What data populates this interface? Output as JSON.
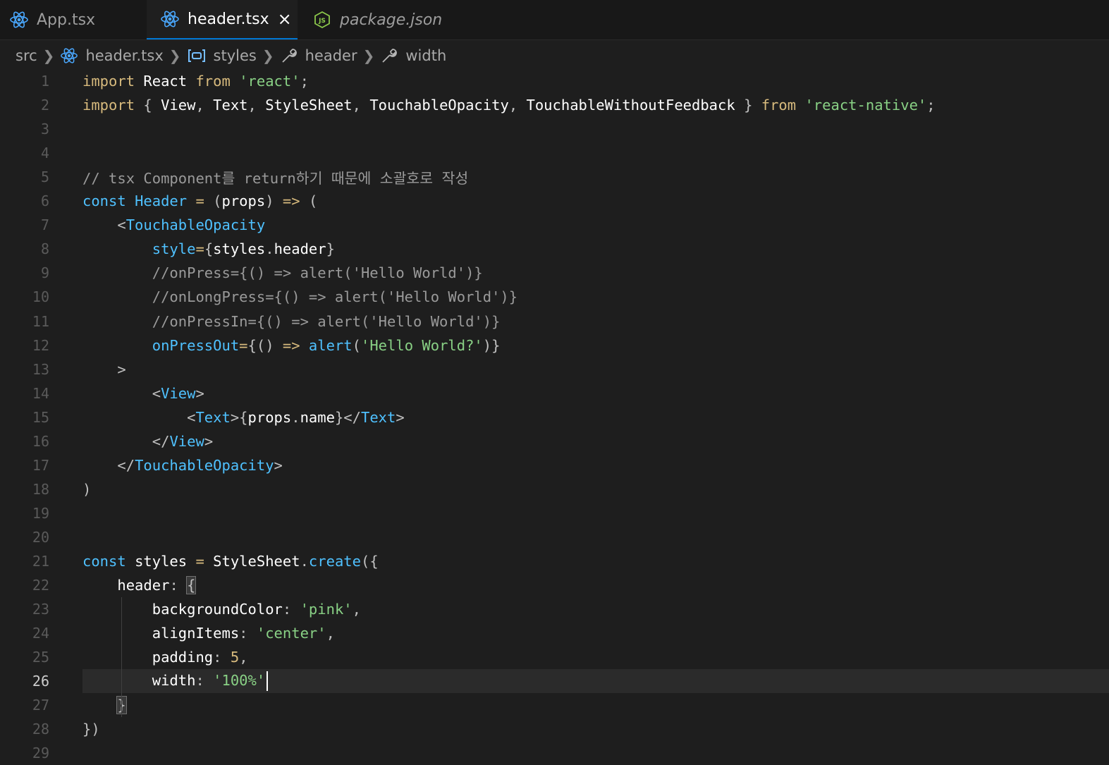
{
  "tabs": [
    {
      "label": "App.tsx",
      "icon": "react-icon",
      "active": false
    },
    {
      "label": "header.tsx",
      "icon": "react-icon",
      "active": true,
      "close": "×"
    },
    {
      "label": "package.json",
      "icon": "nodejs-icon",
      "active": false
    }
  ],
  "breadcrumb": [
    {
      "label": "src"
    },
    {
      "label": "header.tsx",
      "icon": "react-icon"
    },
    {
      "label": "styles",
      "icon": "variable-icon"
    },
    {
      "label": "header",
      "icon": "wrench-icon"
    },
    {
      "label": "width",
      "icon": "wrench-icon"
    }
  ],
  "colors": {
    "keyword": "#c586c0",
    "import": "#d7ba7d",
    "string": "#89d185",
    "identifier": "#ffffff",
    "type": "#4fc1ff",
    "comment": "#9a9a9a",
    "tag": "#4ec9b0",
    "number": "#d7ba7d"
  },
  "editor": {
    "current_line": 26,
    "lines": [
      {
        "n": "1",
        "tokens": [
          [
            "kwy",
            "import"
          ],
          [
            "p",
            " "
          ],
          [
            "id",
            "React"
          ],
          [
            "p",
            " "
          ],
          [
            "kwy",
            "from"
          ],
          [
            "p",
            " "
          ],
          [
            "str",
            "'react'"
          ],
          [
            "pu",
            ";"
          ]
        ]
      },
      {
        "n": "2",
        "tokens": [
          [
            "kwy",
            "import"
          ],
          [
            "p",
            " "
          ],
          [
            "pu",
            "{"
          ],
          [
            "p",
            " "
          ],
          [
            "id",
            "View"
          ],
          [
            "pu",
            ","
          ],
          [
            "p",
            " "
          ],
          [
            "id",
            "Text"
          ],
          [
            "pu",
            ","
          ],
          [
            "p",
            " "
          ],
          [
            "id",
            "StyleSheet"
          ],
          [
            "pu",
            ","
          ],
          [
            "p",
            " "
          ],
          [
            "id",
            "TouchableOpacity"
          ],
          [
            "pu",
            ","
          ],
          [
            "p",
            " "
          ],
          [
            "id",
            "TouchableWithoutFeedback"
          ],
          [
            "p",
            " "
          ],
          [
            "pu",
            "}"
          ],
          [
            "p",
            " "
          ],
          [
            "kwy",
            "from"
          ],
          [
            "p",
            " "
          ],
          [
            "str",
            "'react-native'"
          ],
          [
            "pu",
            ";"
          ]
        ]
      },
      {
        "n": "3",
        "tokens": []
      },
      {
        "n": "4",
        "tokens": []
      },
      {
        "n": "5",
        "tokens": [
          [
            "cm",
            "// tsx Component를 return하기 때문에 소괄호로 작성"
          ]
        ]
      },
      {
        "n": "6",
        "tokens": [
          [
            "kwb",
            "const"
          ],
          [
            "p",
            " "
          ],
          [
            "ty",
            "Header"
          ],
          [
            "p",
            " "
          ],
          [
            "op",
            "="
          ],
          [
            "p",
            " "
          ],
          [
            "pu",
            "("
          ],
          [
            "id",
            "props"
          ],
          [
            "pu",
            ")"
          ],
          [
            "p",
            " "
          ],
          [
            "kwy",
            "=>"
          ],
          [
            "p",
            " "
          ],
          [
            "pu",
            "("
          ]
        ]
      },
      {
        "n": "7",
        "tokens": [
          [
            "p",
            "    "
          ],
          [
            "pu",
            "<"
          ],
          [
            "tg",
            "TouchableOpacity"
          ]
        ]
      },
      {
        "n": "8",
        "tokens": [
          [
            "p",
            "        "
          ],
          [
            "at",
            "style"
          ],
          [
            "op",
            "="
          ],
          [
            "pu",
            "{"
          ],
          [
            "id",
            "styles"
          ],
          [
            "pu",
            "."
          ],
          [
            "id",
            "header"
          ],
          [
            "pu",
            "}"
          ]
        ]
      },
      {
        "n": "9",
        "tokens": [
          [
            "p",
            "        "
          ],
          [
            "cm",
            "//onPress={() => alert('Hello World')}"
          ]
        ]
      },
      {
        "n": "10",
        "tokens": [
          [
            "p",
            "        "
          ],
          [
            "cm",
            "//onLongPress={() => alert('Hello World')}"
          ]
        ]
      },
      {
        "n": "11",
        "tokens": [
          [
            "p",
            "        "
          ],
          [
            "cm",
            "//onPressIn={() => alert('Hello World')}"
          ]
        ]
      },
      {
        "n": "12",
        "tokens": [
          [
            "p",
            "        "
          ],
          [
            "at",
            "onPressOut"
          ],
          [
            "op",
            "="
          ],
          [
            "pu",
            "{"
          ],
          [
            "pu",
            "()"
          ],
          [
            "p",
            " "
          ],
          [
            "kwy",
            "=>"
          ],
          [
            "p",
            " "
          ],
          [
            "fn",
            "alert"
          ],
          [
            "pu",
            "("
          ],
          [
            "str",
            "'Hello World?'"
          ],
          [
            "pu",
            ")}"
          ]
        ]
      },
      {
        "n": "13",
        "tokens": [
          [
            "p",
            "    "
          ],
          [
            "pu",
            ">"
          ]
        ]
      },
      {
        "n": "14",
        "tokens": [
          [
            "p",
            "        "
          ],
          [
            "pu",
            "<"
          ],
          [
            "tg",
            "View"
          ],
          [
            "pu",
            ">"
          ]
        ]
      },
      {
        "n": "15",
        "tokens": [
          [
            "p",
            "            "
          ],
          [
            "pu",
            "<"
          ],
          [
            "tg",
            "Text"
          ],
          [
            "pu",
            ">"
          ],
          [
            "pu",
            "{"
          ],
          [
            "id",
            "props"
          ],
          [
            "pu",
            "."
          ],
          [
            "id",
            "name"
          ],
          [
            "pu",
            "}"
          ],
          [
            "pu",
            "</"
          ],
          [
            "tg",
            "Text"
          ],
          [
            "pu",
            ">"
          ]
        ]
      },
      {
        "n": "16",
        "tokens": [
          [
            "p",
            "        "
          ],
          [
            "pu",
            "</"
          ],
          [
            "tg",
            "View"
          ],
          [
            "pu",
            ">"
          ]
        ]
      },
      {
        "n": "17",
        "tokens": [
          [
            "p",
            "    "
          ],
          [
            "pu",
            "</"
          ],
          [
            "tg",
            "TouchableOpacity"
          ],
          [
            "pu",
            ">"
          ]
        ]
      },
      {
        "n": "18",
        "tokens": [
          [
            "pu",
            ")"
          ]
        ]
      },
      {
        "n": "19",
        "tokens": []
      },
      {
        "n": "20",
        "tokens": []
      },
      {
        "n": "21",
        "tokens": [
          [
            "kwb",
            "const"
          ],
          [
            "p",
            " "
          ],
          [
            "id",
            "styles"
          ],
          [
            "p",
            " "
          ],
          [
            "op",
            "="
          ],
          [
            "p",
            " "
          ],
          [
            "id",
            "StyleSheet"
          ],
          [
            "pu",
            "."
          ],
          [
            "fn",
            "create"
          ],
          [
            "pu",
            "({"
          ]
        ]
      },
      {
        "n": "22",
        "tokens": [
          [
            "p",
            "    "
          ],
          [
            "id",
            "header"
          ],
          [
            "pu",
            ":"
          ],
          [
            "p",
            " "
          ],
          [
            "bx",
            "{"
          ]
        ]
      },
      {
        "n": "23",
        "tokens": [
          [
            "p",
            "        "
          ],
          [
            "id",
            "backgroundColor"
          ],
          [
            "pu",
            ":"
          ],
          [
            "p",
            " "
          ],
          [
            "str",
            "'pink'"
          ],
          [
            "pu",
            ","
          ]
        ]
      },
      {
        "n": "24",
        "tokens": [
          [
            "p",
            "        "
          ],
          [
            "id",
            "alignItems"
          ],
          [
            "pu",
            ":"
          ],
          [
            "p",
            " "
          ],
          [
            "str",
            "'center'"
          ],
          [
            "pu",
            ","
          ]
        ]
      },
      {
        "n": "25",
        "tokens": [
          [
            "p",
            "        "
          ],
          [
            "id",
            "padding"
          ],
          [
            "pu",
            ":"
          ],
          [
            "p",
            " "
          ],
          [
            "nm",
            "5"
          ],
          [
            "pu",
            ","
          ]
        ]
      },
      {
        "n": "26",
        "tokens": [
          [
            "p",
            "        "
          ],
          [
            "id",
            "width"
          ],
          [
            "pu",
            ":"
          ],
          [
            "p",
            " "
          ],
          [
            "str",
            "'100%'"
          ]
        ]
      },
      {
        "n": "27",
        "tokens": [
          [
            "p",
            "    "
          ],
          [
            "bx",
            "}"
          ]
        ]
      },
      {
        "n": "28",
        "tokens": [
          [
            "pu",
            "})"
          ]
        ]
      },
      {
        "n": "29",
        "tokens": []
      }
    ]
  }
}
